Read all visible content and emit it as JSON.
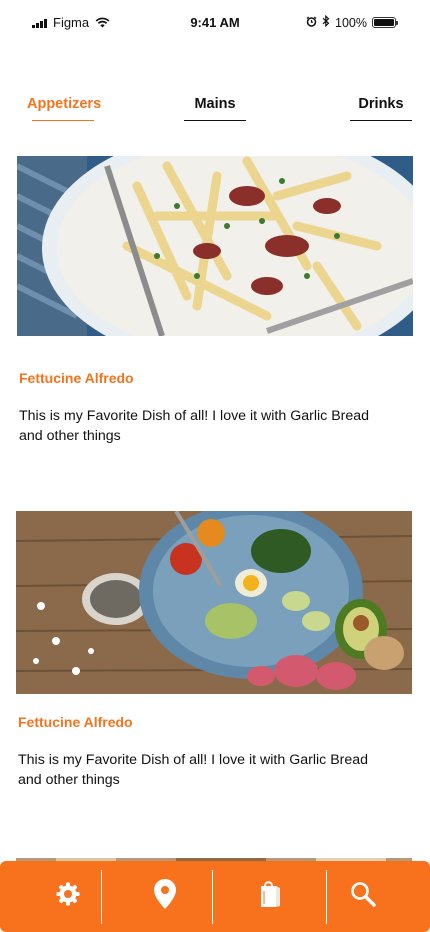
{
  "status_bar": {
    "carrier": "Figma",
    "time": "9:41 AM",
    "battery": "100%"
  },
  "tabs": [
    {
      "label": "Appetizers",
      "active": true
    },
    {
      "label": "Mains",
      "active": false
    },
    {
      "label": "Drinks",
      "active": false
    }
  ],
  "cards": [
    {
      "title": "Fettucine Alfredo",
      "description": "This is my Favorite Dish of all! I love it with Garlic Bread\n and other things",
      "image": "fries-with-bacon-photo"
    },
    {
      "title": "Fettucine Alfredo",
      "description": "This is my Favorite Dish of all! I love it with Garlic Bread\n and other things",
      "image": "salad-bowl-photo"
    }
  ],
  "bottom_nav": {
    "items": [
      "gear-icon",
      "location-pin-icon",
      "shopping-bag-icon",
      "search-icon"
    ]
  },
  "colors": {
    "accent": "#f3741e",
    "nav_background": "#f8721d"
  }
}
